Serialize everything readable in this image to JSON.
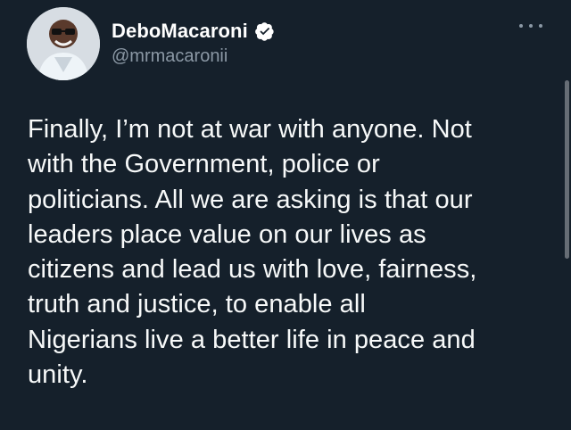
{
  "tweet": {
    "author": {
      "display_name": "DeboMacaroni",
      "handle": "@mrmacaronii",
      "verified": true
    },
    "text": "Finally, I’m not at war with anyone. Not\nwith the Government, police or\npoliticians. All we are asking is that our\nleaders place value on our lives as\ncitizens and lead us with love, fairness,\ntruth and justice, to enable all\nNigerians live a better life in peace and\nunity."
  },
  "icons": {
    "verified": "verified-badge-icon",
    "more": "more-options-icon"
  },
  "colors": {
    "background": "#15202b",
    "primary_text": "#f7f9f9",
    "secondary_text": "#8b98a5",
    "verified_badge": "#ffffff"
  }
}
